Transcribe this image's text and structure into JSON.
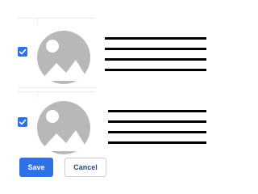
{
  "items": [
    {
      "checked": true,
      "image_icon": "image-placeholder-icon"
    },
    {
      "checked": true,
      "image_icon": "image-placeholder-icon"
    }
  ],
  "footer": {
    "save_label": "Save",
    "cancel_label": "Cancel"
  },
  "colors": {
    "accent": "#2f72e6",
    "placeholder_gray": "#b8b8b8",
    "text_line": "#000000",
    "divider": "#ececec"
  }
}
